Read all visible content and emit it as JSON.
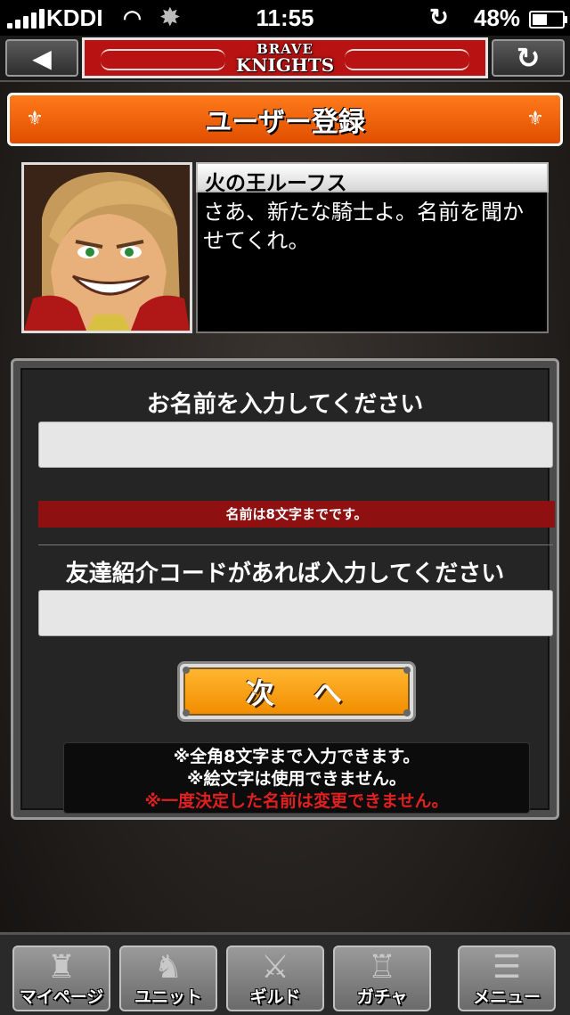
{
  "status_bar": {
    "carrier": "KDDI",
    "time": "11:55",
    "battery": "48%"
  },
  "header": {
    "logo_line1": "BRAVE",
    "logo_line2": "KNIGHTS",
    "back_icon": "back-arrow",
    "reload_icon": "reload"
  },
  "title": "ユーザー登録",
  "speaker": {
    "name": "火の王ルーフス",
    "message": "さあ、新たな騎士よ。名前を聞かせてくれ。"
  },
  "form": {
    "name_label": "お名前を入力してください",
    "name_value": "",
    "name_error": "名前は8文字までです。",
    "code_label": "友達紹介コードがあれば入力してください",
    "code_value": "",
    "next_label": "次　へ"
  },
  "notes": {
    "line1": "※全角8文字まで入力できます。",
    "line2": "※絵文字は使用できません。",
    "warning": "※一度決定した名前は変更できません。"
  },
  "colors": {
    "title_bar": "#e85a00",
    "error_bar": "#8e1010",
    "button": "#f5a000",
    "warning_text": "#e02020"
  },
  "nav": [
    {
      "label": "マイページ",
      "icon": "castle-icon"
    },
    {
      "label": "ユニット",
      "icon": "knight-helmet-icon"
    },
    {
      "label": "ギルド",
      "icon": "crossed-swords-icon"
    },
    {
      "label": "ガチャ",
      "icon": "tower-icon"
    },
    {
      "label": "メニュー",
      "icon": "menu-icon"
    }
  ]
}
